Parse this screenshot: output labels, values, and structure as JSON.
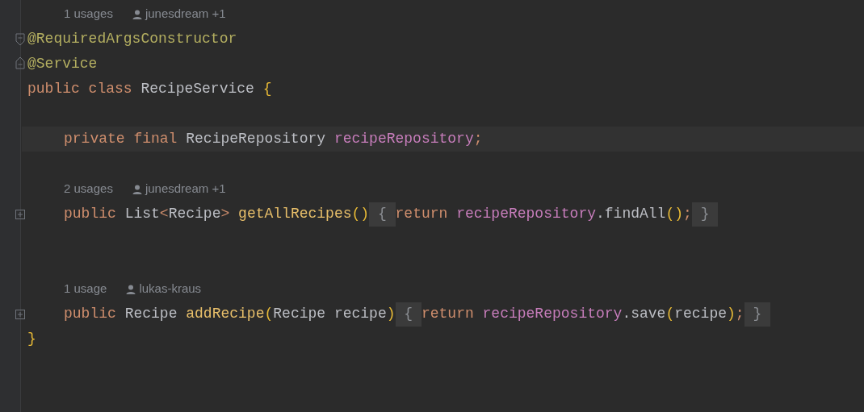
{
  "lines": [
    {
      "kind": "hint",
      "usages": "1 usages",
      "author": "junesdream +1"
    },
    {
      "kind": "code",
      "marker": {
        "kind": "fold-start"
      },
      "current": false,
      "tokens": [
        {
          "kind": "annotation",
          "s": "@RequiredArgsConstructor"
        }
      ]
    },
    {
      "kind": "code",
      "marker": {
        "kind": "fold-end"
      },
      "current": false,
      "tokens": [
        {
          "kind": "annotation",
          "s": "@Service"
        }
      ]
    },
    {
      "kind": "code",
      "current": false,
      "tokens": [
        {
          "kind": "keyword",
          "s": "public class "
        },
        {
          "kind": "type",
          "s": "RecipeService "
        },
        {
          "kind": "brace",
          "s": "{"
        }
      ],
      "children": [
        {
          "kind": "empty"
        },
        {
          "kind": "code",
          "current": true,
          "tokens": [
            {
              "kind": "keyword",
              "s": "private final "
            },
            {
              "kind": "type",
              "s": "RecipeRepository "
            },
            {
              "kind": "field",
              "s": "recipeRepository"
            },
            {
              "kind": "keyword",
              "s": ";"
            }
          ]
        },
        {
          "kind": "empty"
        },
        {
          "kind": "hint",
          "usages": "2 usages",
          "author": "junesdream +1"
        },
        {
          "kind": "code",
          "marker": {
            "kind": "collapsed"
          },
          "current": false,
          "tokens": [
            {
              "kind": "keyword",
              "s": "public "
            },
            {
              "kind": "type",
              "s": "List"
            },
            {
              "kind": "keyword",
              "s": "<"
            },
            {
              "kind": "type",
              "s": "Recipe"
            },
            {
              "kind": "keyword",
              "s": "> "
            },
            {
              "kind": "method",
              "s": "getAllRecipes"
            },
            {
              "kind": "brace",
              "s": "()"
            },
            {
              "kind": "folded",
              "s": " { "
            },
            {
              "kind": "keyword",
              "s": "return "
            },
            {
              "kind": "field",
              "s": "recipeRepository"
            },
            {
              "kind": "type",
              "s": ".findAll"
            },
            {
              "kind": "brace",
              "s": "()"
            },
            {
              "kind": "keyword",
              "s": ";"
            },
            {
              "kind": "folded",
              "s": " } "
            }
          ]
        },
        {
          "kind": "empty"
        },
        {
          "kind": "empty"
        },
        {
          "kind": "hint",
          "usages": "1 usage",
          "author": "lukas-kraus"
        },
        {
          "kind": "code",
          "marker": {
            "kind": "collapsed"
          },
          "current": false,
          "tokens": [
            {
              "kind": "keyword",
              "s": "public "
            },
            {
              "kind": "type",
              "s": "Recipe "
            },
            {
              "kind": "method",
              "s": "addRecipe"
            },
            {
              "kind": "brace",
              "s": "("
            },
            {
              "kind": "type",
              "s": "Recipe recipe"
            },
            {
              "kind": "brace",
              "s": ")"
            },
            {
              "kind": "folded",
              "s": " { "
            },
            {
              "kind": "keyword",
              "s": "return "
            },
            {
              "kind": "field",
              "s": "recipeRepository"
            },
            {
              "kind": "type",
              "s": ".save"
            },
            {
              "kind": "brace",
              "s": "("
            },
            {
              "kind": "type",
              "s": "recipe"
            },
            {
              "kind": "brace",
              "s": ")"
            },
            {
              "kind": "keyword",
              "s": ";"
            },
            {
              "kind": "folded",
              "s": " } "
            }
          ]
        }
      ]
    },
    {
      "kind": "code",
      "current": false,
      "tokens": [
        {
          "kind": "brace",
          "s": "}"
        }
      ]
    }
  ]
}
